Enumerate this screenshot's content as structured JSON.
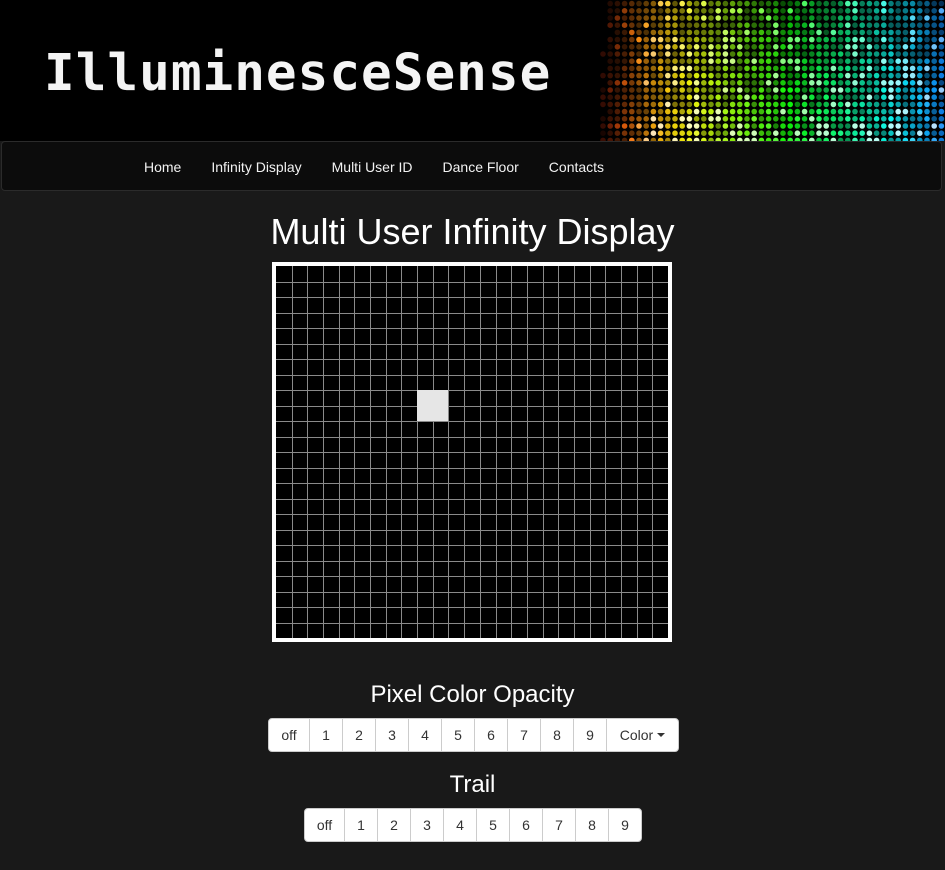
{
  "banner": {
    "logo": "IlluminesceSense",
    "led_art": "led-dot-matrix-rainbow"
  },
  "nav": {
    "items": [
      {
        "label": "Home"
      },
      {
        "label": "Infinity Display"
      },
      {
        "label": "Multi User ID"
      },
      {
        "label": "Dance Floor"
      },
      {
        "label": "Contacts"
      }
    ]
  },
  "main": {
    "title": "Multi User Infinity Display",
    "display": {
      "grid_columns": 25,
      "grid_rows": 24,
      "lit_pixel": {
        "column": 9,
        "row": 8,
        "span": 2,
        "color": "#e6e6e6"
      },
      "grid_line_color": "#8a8a8a",
      "background_color": "#000000"
    },
    "opacity": {
      "title": "Pixel Color Opacity",
      "buttons": [
        "off",
        "1",
        "2",
        "3",
        "4",
        "5",
        "6",
        "7",
        "8",
        "9"
      ],
      "color_label": "Color"
    },
    "trail": {
      "title": "Trail",
      "buttons": [
        "off",
        "1",
        "2",
        "3",
        "4",
        "5",
        "6",
        "7",
        "8",
        "9"
      ]
    }
  },
  "colors": {
    "page_background": "#191919",
    "navbar_background": "#0c0c0c",
    "button_background": "#ffffff"
  }
}
